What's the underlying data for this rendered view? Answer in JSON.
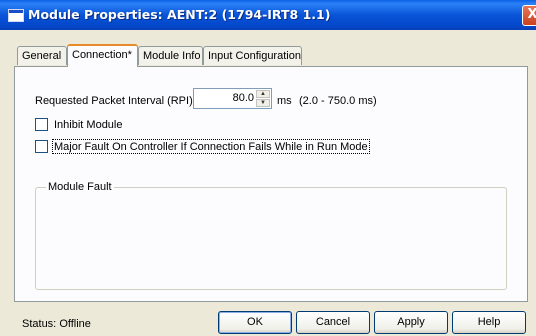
{
  "window": {
    "title": "Module Properties: AENT:2 (1794-IRT8 1.1)",
    "close_glyph": "X",
    "icon": "window-icon"
  },
  "tabs": [
    {
      "label": "General",
      "active": false
    },
    {
      "label": "Connection*",
      "active": true
    },
    {
      "label": "Module Info",
      "active": false
    },
    {
      "label": "Input Configuration",
      "active": false
    }
  ],
  "connection": {
    "rpi_label": "Requested Packet Interval (RPI):",
    "rpi_value": "80.0",
    "rpi_unit": "ms",
    "rpi_range": "(2.0 - 750.0 ms)",
    "inhibit_label": "Inhibit Module",
    "inhibit_checked": false,
    "major_fault_label": "Major Fault On Controller If Connection Fails While in Run Mode",
    "major_fault_checked": false,
    "module_fault_title": "Module Fault"
  },
  "status": {
    "label": "Status:",
    "value": "Offline"
  },
  "buttons": {
    "ok": "OK",
    "cancel": "Cancel",
    "apply": "Apply",
    "help": "Help"
  },
  "colors": {
    "titlebar": "#0954d8",
    "dialog_bg": "#ece9d8",
    "tab_highlight": "#e68b2c",
    "close": "#c9411c"
  }
}
